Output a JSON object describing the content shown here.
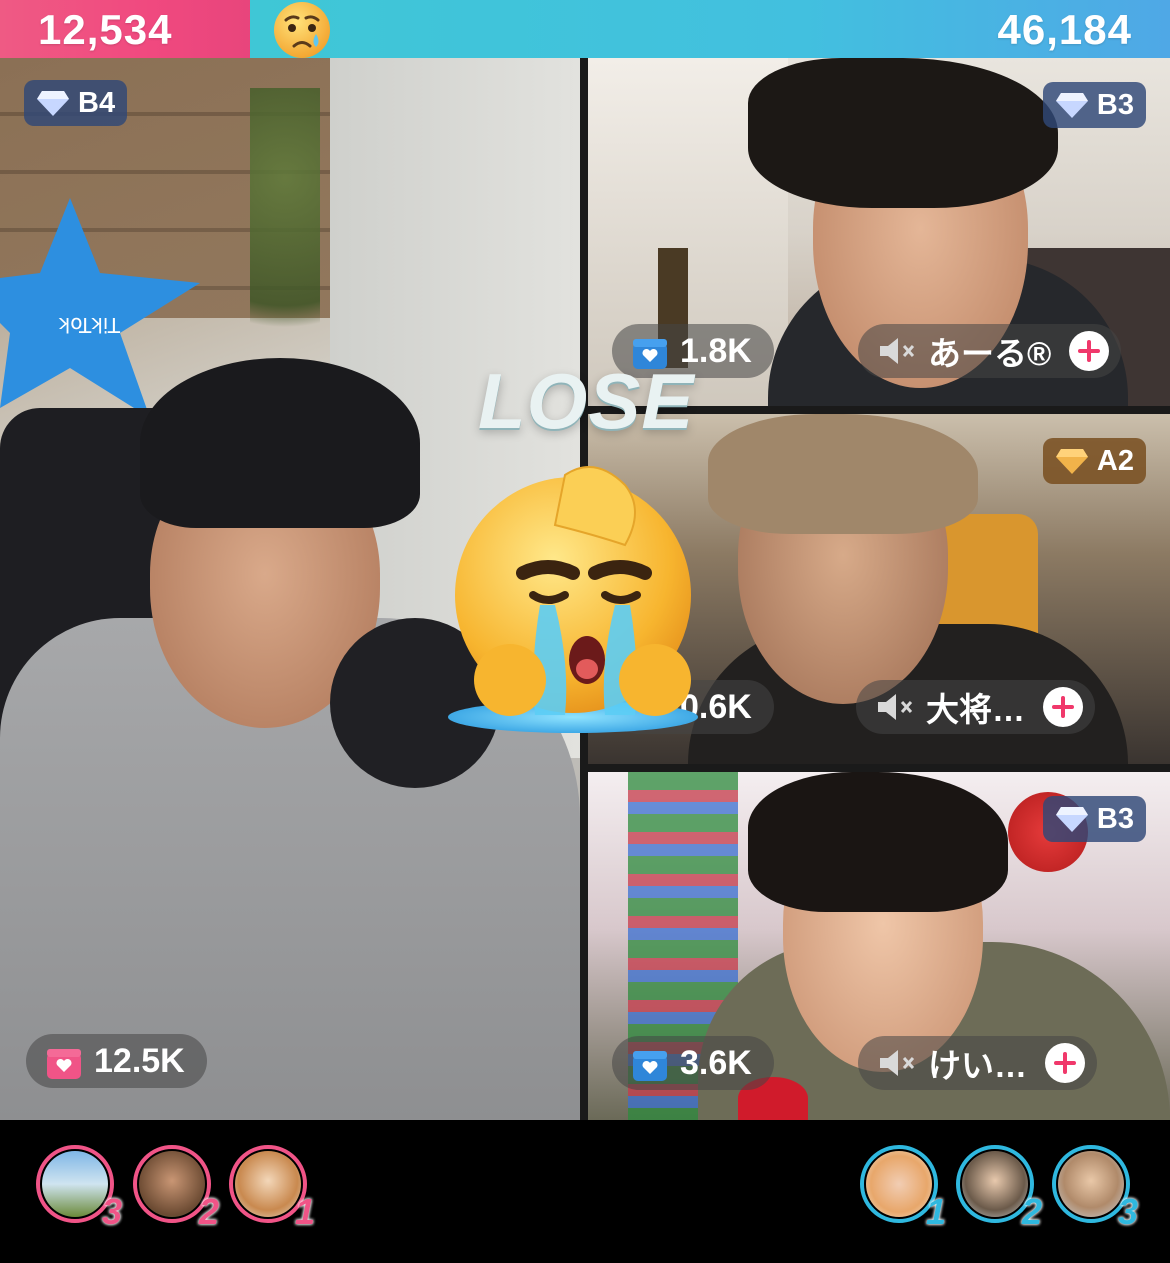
{
  "score": {
    "left": "12,534",
    "right": "46,184",
    "left_share": 0.2135,
    "left_color": "#ef5a84",
    "right_color": "#42c0df",
    "divider_icon": "sad-tear-face-icon"
  },
  "result": {
    "text": "LOSE",
    "icon": "crying-face-icon"
  },
  "host": {
    "rank": "B4",
    "gifts": "12.5K",
    "gift_icon": "gift-box-icon",
    "gift_icon_color": "#f05487"
  },
  "guests": [
    {
      "rank": "B3",
      "rank_tier": "diamond",
      "gifts": "1.8K",
      "name": "あーる®",
      "muted": true
    },
    {
      "rank": "A2",
      "rank_tier": "gold",
      "gifts": "0.6K",
      "name": "大将…",
      "muted": true
    },
    {
      "rank": "B3",
      "rank_tier": "diamond",
      "gifts": "3.6K",
      "name": "けい…",
      "muted": true
    }
  ],
  "supporters_left": [
    {
      "rank": "3",
      "color": "#f05487"
    },
    {
      "rank": "2",
      "color": "#f05487"
    },
    {
      "rank": "1",
      "color": "#f05487"
    }
  ],
  "supporters_right": [
    {
      "rank": "1",
      "color": "#2fb8df"
    },
    {
      "rank": "2",
      "color": "#2fb8df"
    },
    {
      "rank": "3",
      "color": "#2fb8df"
    }
  ]
}
